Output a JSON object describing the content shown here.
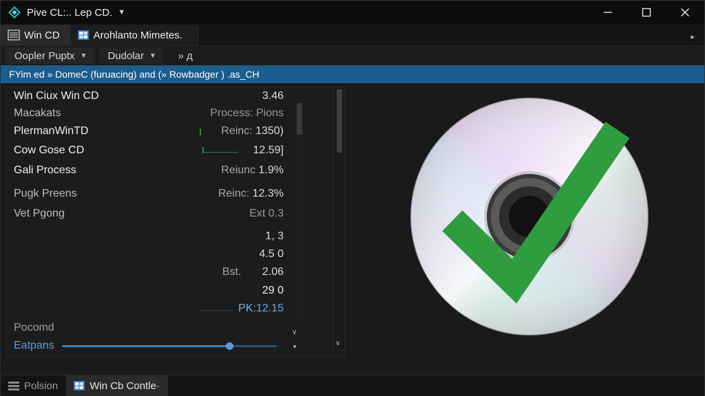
{
  "window": {
    "title": "Pive CL:.. Lep CD.",
    "controls": {
      "minimize": "minimize-icon",
      "maximize": "maximize-icon",
      "close": "close-icon"
    }
  },
  "tabs": [
    {
      "label": "Win CD",
      "icon": "list-icon",
      "active": true
    },
    {
      "label": "Arohlanto Mimetes.",
      "icon": "windows-logo-icon",
      "active": false
    }
  ],
  "toolbar": {
    "dropdown1": "Oopler Puptx",
    "dropdown2": "Dudolar",
    "more": "» д"
  },
  "path": {
    "text": "FYim ed » DomeC (furuacing) and (» Rowbadger ) .as_CH"
  },
  "list": [
    {
      "name": "Win Ciux Win CD",
      "value": "3.46",
      "name_dim": false
    },
    {
      "name": "Macakats",
      "value": "Process: Pions",
      "name_dim": true
    },
    {
      "name": "PlermanWinTD",
      "label": "Reinc:",
      "value": "1350)"
    },
    {
      "name": "Cow Gose CD",
      "value": "12.59]"
    },
    {
      "name": "Gali Process",
      "label": "Reiunc",
      "value": "1.9%"
    },
    {
      "name": "Pugk Preens",
      "label": "Reinc:",
      "value": "12.3%",
      "name_dim": true
    },
    {
      "name": "Vet Pgong",
      "value": "Ext 0.3",
      "name_dim": true
    },
    {
      "name": "",
      "value": "1,   3"
    },
    {
      "name": "",
      "value": "4.5 0"
    },
    {
      "name": "",
      "label": "Bst.",
      "value": "2.06"
    },
    {
      "name": "",
      "value": "29 0"
    },
    {
      "name": "",
      "label": "PK:",
      "value": "12.15",
      "blue": true
    }
  ],
  "footer": {
    "label1": "Pocomd",
    "label2": "Eatpans",
    "slider_level": 0.78
  },
  "status": [
    {
      "label": "Polsion",
      "icon": "settings-bars-icon"
    },
    {
      "label": "Win Cb Contle·",
      "icon": "windows-logo-icon"
    }
  ],
  "colors": {
    "accent": "#1b5d8e",
    "check": "#2e9c3f",
    "background": "#1a1a1a"
  }
}
